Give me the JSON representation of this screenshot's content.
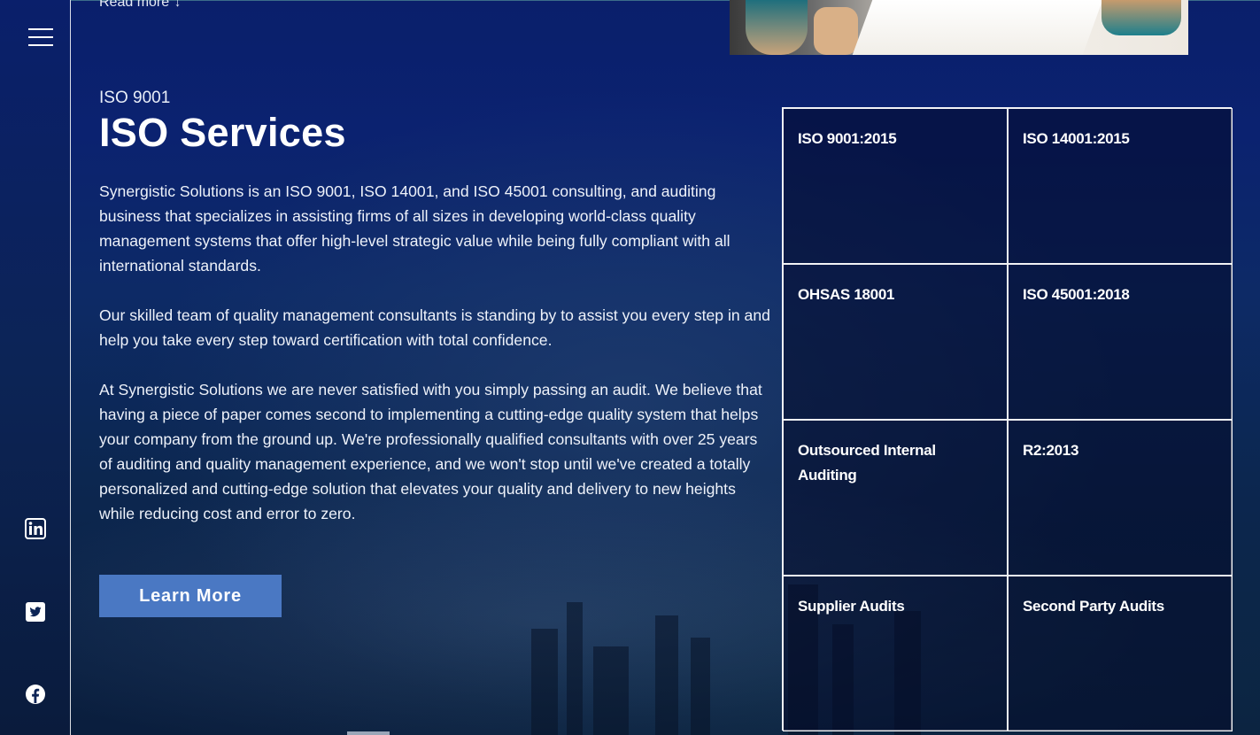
{
  "nav": {
    "read_more": "Read more",
    "read_more_icon": "chevron-down-icon"
  },
  "section": {
    "eyebrow": "ISO 9001",
    "title": "ISO Services",
    "paragraphs": [
      "Synergistic Solutions is an ISO 9001, ISO 14001, and ISO 45001 consulting, and auditing business that specializes in assisting firms of all sizes in developing world-class quality management systems that offer high-level strategic value while being fully compliant with all international standards.",
      "Our skilled team of quality management consultants is standing by to assist you every step in and help you take every step toward certification with total confidence.",
      "At Synergistic Solutions we are never satisfied with you simply passing an audit. We believe that having a piece of paper comes second to implementing a cutting-edge quality system that helps your company from the ground up. We're professionally qualified consultants with over 25 years of auditing and quality management experience, and we won't stop until we've created a totally personalized and cutting-edge solution that elevates your quality and delivery to new heights while reducing cost and error to zero."
    ],
    "button_label": "Learn More"
  },
  "services": [
    "ISO 9001:2015",
    "ISO 14001:2015",
    "OHSAS 18001",
    "ISO 45001:2018",
    "Outsourced Internal Auditing",
    "R2:2013",
    "Supplier Audits",
    "Second Party Audits"
  ],
  "sidebar": {
    "icons": [
      "menu-icon",
      "linkedin-icon",
      "twitter-icon",
      "facebook-icon"
    ]
  },
  "colors": {
    "background": "#0a1f6b",
    "button": "#4a78c3",
    "text": "#ffffff"
  }
}
